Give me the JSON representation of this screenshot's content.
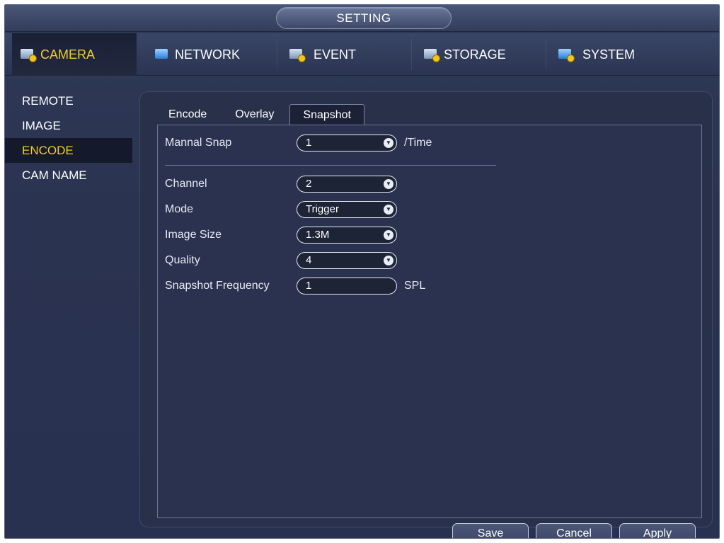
{
  "window": {
    "title": "SETTING"
  },
  "topnav": [
    {
      "label": "CAMERA",
      "icon": "camera-icon",
      "active": true
    },
    {
      "label": "NETWORK",
      "icon": "network-icon",
      "active": false
    },
    {
      "label": "EVENT",
      "icon": "event-icon",
      "active": false
    },
    {
      "label": "STORAGE",
      "icon": "storage-icon",
      "active": false
    },
    {
      "label": "SYSTEM",
      "icon": "system-icon",
      "active": false
    }
  ],
  "sidebar": [
    {
      "label": "REMOTE",
      "active": false
    },
    {
      "label": "IMAGE",
      "active": false
    },
    {
      "label": "ENCODE",
      "active": true
    },
    {
      "label": "CAM NAME",
      "active": false
    }
  ],
  "tabs": [
    {
      "label": "Encode",
      "active": false
    },
    {
      "label": "Overlay",
      "active": false
    },
    {
      "label": "Snapshot",
      "active": true
    }
  ],
  "form": {
    "manual_snap": {
      "label": "Mannal Snap",
      "value": "1",
      "unit": "/Time"
    },
    "channel": {
      "label": "Channel",
      "value": "2"
    },
    "mode": {
      "label": "Mode",
      "value": "Trigger"
    },
    "image_size": {
      "label": "Image Size",
      "value": "1.3M"
    },
    "quality": {
      "label": "Quality",
      "value": "4"
    },
    "snapshot_frequency": {
      "label": "Snapshot Frequency",
      "value": "1",
      "unit": "SPL"
    }
  },
  "buttons": {
    "save": "Save",
    "cancel": "Cancel",
    "apply": "Apply"
  },
  "colors": {
    "accent": "#f2cc2a",
    "background": "#2a3250"
  }
}
